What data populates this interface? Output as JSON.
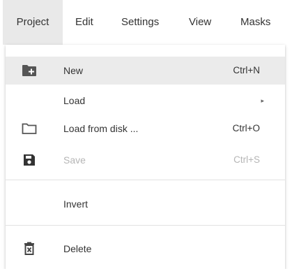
{
  "menubar": {
    "items": [
      "Project",
      "Edit",
      "Settings",
      "View",
      "Masks"
    ],
    "active": "Project"
  },
  "menu": {
    "items": [
      {
        "label": "New",
        "shortcut": "Ctrl+N",
        "icon": "folder-plus-icon",
        "state": "hovered"
      },
      {
        "label": "Load",
        "submenu": true,
        "icon": "none",
        "arrow": "▸"
      },
      {
        "label": "Load from disk ...",
        "shortcut": "Ctrl+O",
        "icon": "folder-outline-icon"
      },
      {
        "label": "Save",
        "shortcut": "Ctrl+S",
        "icon": "save-icon",
        "state": "disabled"
      },
      {
        "label": "Invert",
        "icon": "none"
      },
      {
        "label": "Delete",
        "icon": "delete-icon"
      }
    ]
  },
  "colors": {
    "text": "#333333",
    "disabled_text": "#b5b5b5",
    "hover_bg": "#ebebeb",
    "active_menubar_bg": "#e9e9e9",
    "icon": "#555555"
  }
}
